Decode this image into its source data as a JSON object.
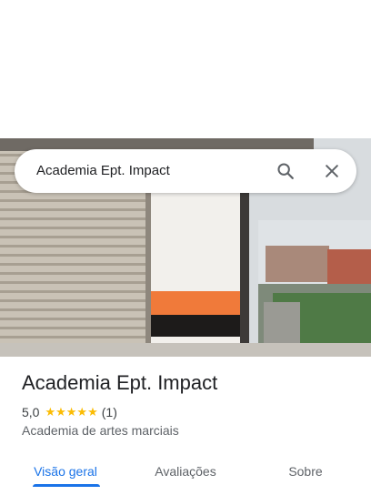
{
  "search": {
    "query": "Academia Ept. Impact",
    "search_icon": "search-icon",
    "close_icon": "close-icon"
  },
  "place": {
    "name": "Academia Ept. Impact",
    "rating": "5,0",
    "stars": "★★★★★",
    "review_count": "(1)",
    "category": "Academia de artes marciais"
  },
  "tabs": [
    {
      "label": "Visão geral",
      "active": true
    },
    {
      "label": "Avaliações",
      "active": false
    },
    {
      "label": "Sobre",
      "active": false
    }
  ],
  "colors": {
    "accent": "#1a73e8",
    "star": "#fbbc04"
  }
}
